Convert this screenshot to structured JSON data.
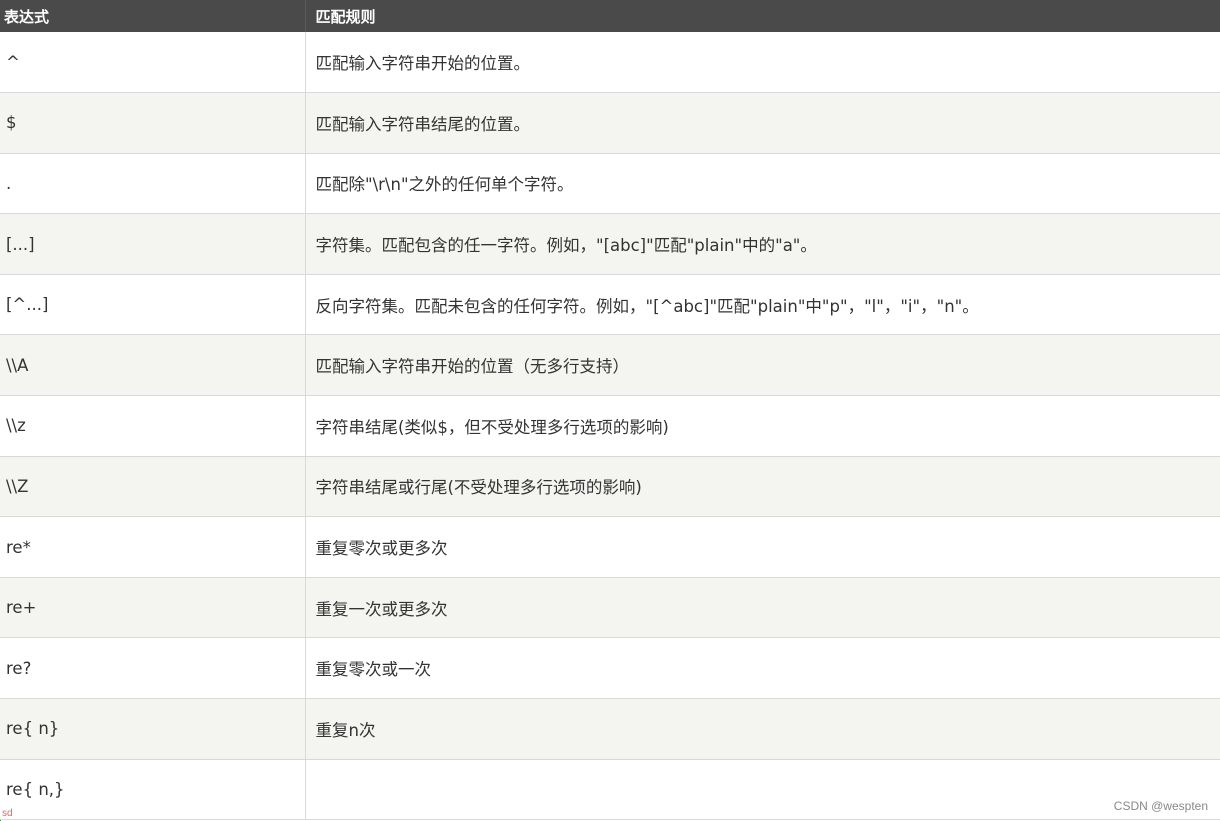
{
  "table": {
    "headers": {
      "expression": "表达式",
      "rule": "匹配规则"
    },
    "rows": [
      {
        "expr": "^",
        "rule": "匹配输入字符串开始的位置。"
      },
      {
        "expr": "$",
        "rule": "匹配输入字符串结尾的位置。"
      },
      {
        "expr": ".",
        "rule": "匹配除\"\\r\\n\"之外的任何单个字符。"
      },
      {
        "expr": "[...]",
        "rule": "字符集。匹配包含的任一字符。例如，\"[abc]\"匹配\"plain\"中的\"a\"。"
      },
      {
        "expr": "[^...]",
        "rule": "反向字符集。匹配未包含的任何字符。例如，\"[^abc]\"匹配\"plain\"中\"p\"，\"l\"，\"i\"，\"n\"。"
      },
      {
        "expr": "\\\\A",
        "rule": "匹配输入字符串开始的位置（无多行支持）"
      },
      {
        "expr": "\\\\z",
        "rule": "字符串结尾(类似$，但不受处理多行选项的影响)"
      },
      {
        "expr": "\\\\Z",
        "rule": "字符串结尾或行尾(不受处理多行选项的影响)"
      },
      {
        "expr": "re*",
        "rule": "重复零次或更多次"
      },
      {
        "expr": "re+",
        "rule": "重复一次或更多次"
      },
      {
        "expr": "re?",
        "rule": "重复零次或一次"
      },
      {
        "expr": "re{ n}",
        "rule": "重复n次"
      },
      {
        "expr": "re{ n,}",
        "rule": ""
      }
    ]
  },
  "watermark": "CSDN @wespten",
  "corner_mark": "sd"
}
